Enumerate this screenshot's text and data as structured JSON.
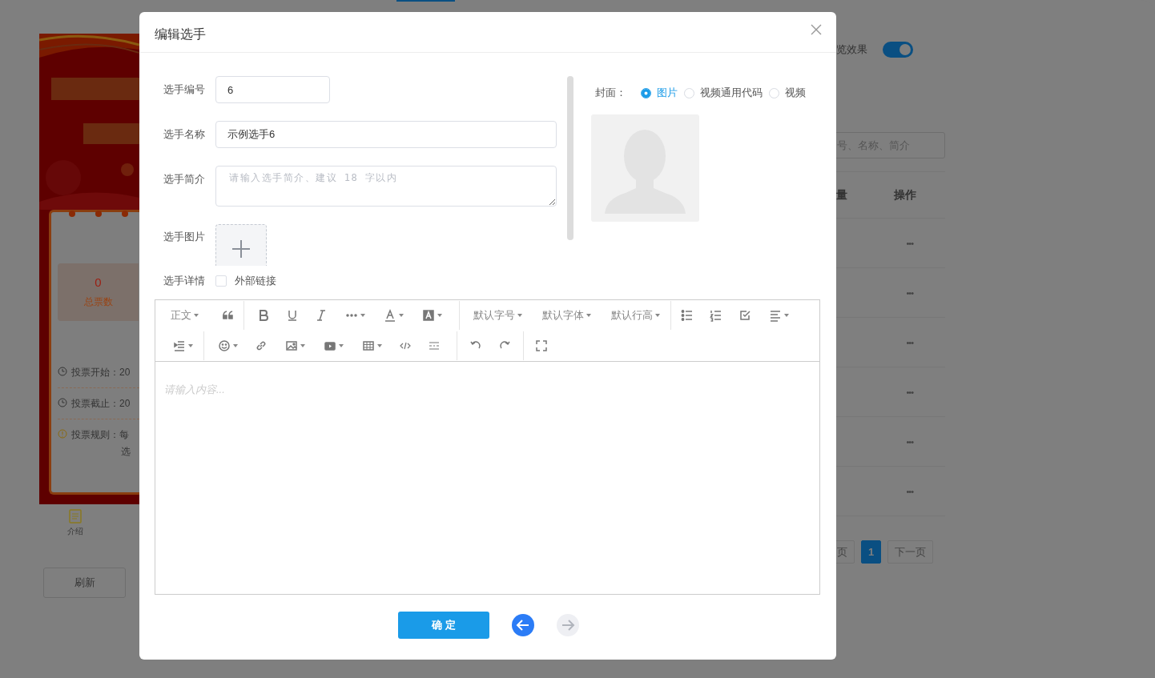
{
  "background_page": {
    "phone": {
      "stats": {
        "value": "0",
        "label": "总票数"
      },
      "info": [
        {
          "kind": "time",
          "text": "投票开始：20"
        },
        {
          "kind": "time",
          "text": "投票截止：20"
        },
        {
          "kind": "rule",
          "text": "投票规则：每",
          "continuation": "选"
        }
      ],
      "tabs": [
        {
          "label": "介绍"
        }
      ]
    },
    "refresh_button": "刷新",
    "preview_toggle": {
      "label": "览效果",
      "on": true
    },
    "search": {
      "placeholder": "号、名称、简介"
    },
    "table": {
      "columns": [
        "量",
        "操作"
      ],
      "rows": [
        {
          "action": "•••"
        },
        {
          "action": "•••"
        },
        {
          "action": "•••"
        },
        {
          "action": "•••"
        },
        {
          "action": "•••"
        },
        {
          "action": "•••"
        }
      ]
    },
    "pagination": [
      {
        "label": "页",
        "selected": false
      },
      {
        "label": "1",
        "selected": true
      },
      {
        "label": "下一页",
        "selected": false
      }
    ]
  },
  "dialog": {
    "title": "编辑选手",
    "fields": [
      {
        "label": "选手编号",
        "kind": "number",
        "value": "6"
      },
      {
        "label": "选手名称",
        "kind": "text",
        "value": "示例选手6"
      },
      {
        "label": "选手简介",
        "kind": "textarea",
        "placeholder": "请输入选手简介、建议 18 字以内"
      },
      {
        "label": "选手图片",
        "kind": "upload"
      },
      {
        "label": "选手详情",
        "kind": "checkbox",
        "option": "外部链接",
        "checked": false
      }
    ],
    "cover": {
      "label": "封面：",
      "options": [
        {
          "label": "图片",
          "selected": true
        },
        {
          "label": "视频通用代码",
          "selected": false
        },
        {
          "label": "视频",
          "selected": false
        }
      ]
    },
    "editor": {
      "toolbar_text": [
        "正文",
        "默认字号",
        "默认字体",
        "默认行高"
      ],
      "placeholder": "请输入内容..."
    },
    "footer": {
      "confirm": "确 定",
      "prev_disabled": false,
      "next_disabled": true
    }
  }
}
